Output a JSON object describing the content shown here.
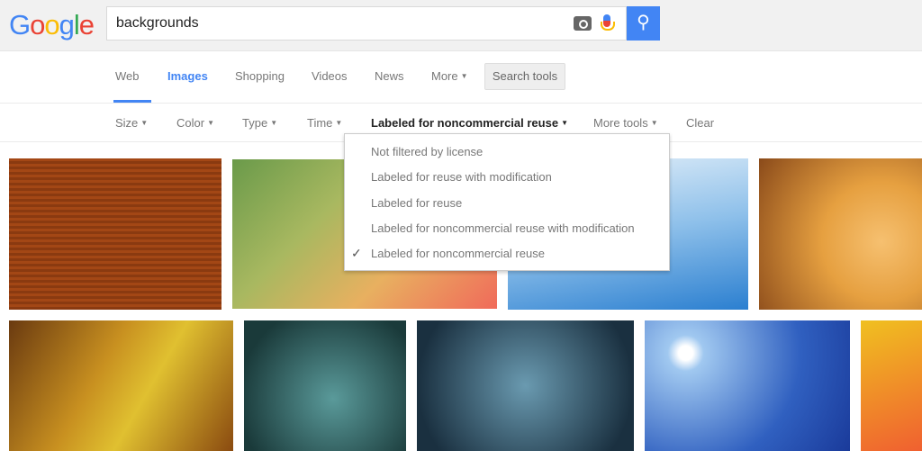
{
  "logo": "Google",
  "search": {
    "query": "backgrounds",
    "camera_icon": "camera-icon",
    "mic_icon": "mic-icon",
    "search_icon": "search-icon"
  },
  "tabs": [
    {
      "label": "Web"
    },
    {
      "label": "Images",
      "active": true
    },
    {
      "label": "Shopping"
    },
    {
      "label": "Videos"
    },
    {
      "label": "News"
    },
    {
      "label": "More"
    }
  ],
  "search_tools_label": "Search tools",
  "tools": [
    {
      "label": "Size"
    },
    {
      "label": "Color"
    },
    {
      "label": "Type"
    },
    {
      "label": "Time"
    },
    {
      "label": "Labeled for noncommercial reuse",
      "active": true
    },
    {
      "label": "More tools"
    }
  ],
  "clear_label": "Clear",
  "license_menu": {
    "items": [
      "Not filtered by license",
      "Labeled for reuse with modification",
      "Labeled for reuse",
      "Labeled for noncommercial reuse with modification",
      "Labeled for noncommercial reuse"
    ],
    "selected": "Labeled for noncommercial reuse"
  },
  "colors": {
    "accent": "#4285f4"
  }
}
